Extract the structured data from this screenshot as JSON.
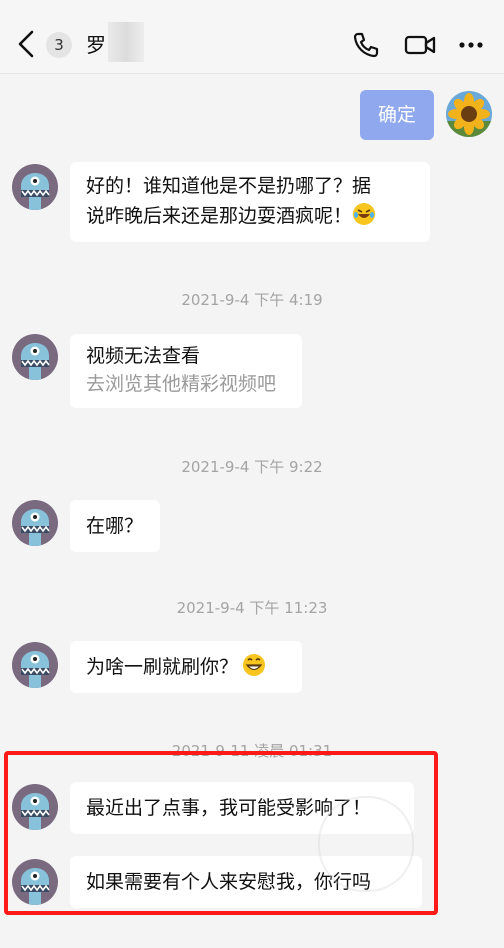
{
  "header": {
    "unread_count": "3",
    "contact_name": "罗",
    "icons": [
      "back-chevron-icon",
      "phone-icon",
      "video-call-icon",
      "more-icon"
    ]
  },
  "colors": {
    "sent_bubble": "#8fa8ee",
    "highlight_border": "#ff1a1a",
    "background": "#f4f4f4"
  },
  "messages": {
    "sent_1": "确定",
    "recv_1": {
      "line1": "好的！谁知道他是不是扔哪了？据",
      "line2": "说昨晚后来还是那边耍酒疯呢！"
    },
    "time_1": "2021-9-4 下午 4:19",
    "recv_2": {
      "title": "视频无法查看",
      "subtitle": "去浏览其他精彩视频吧"
    },
    "time_2": "2021-9-4 下午 9:22",
    "recv_3": "在哪？",
    "time_3": "2021-9-4 下午 11:23",
    "recv_4": "为啥一刷就刷你？",
    "time_4": "2021-9-11 凌晨 01:31",
    "recv_5": "最近出了点事，我可能受影响了！",
    "recv_6": "如果需要有个人来安慰我，你行吗"
  }
}
